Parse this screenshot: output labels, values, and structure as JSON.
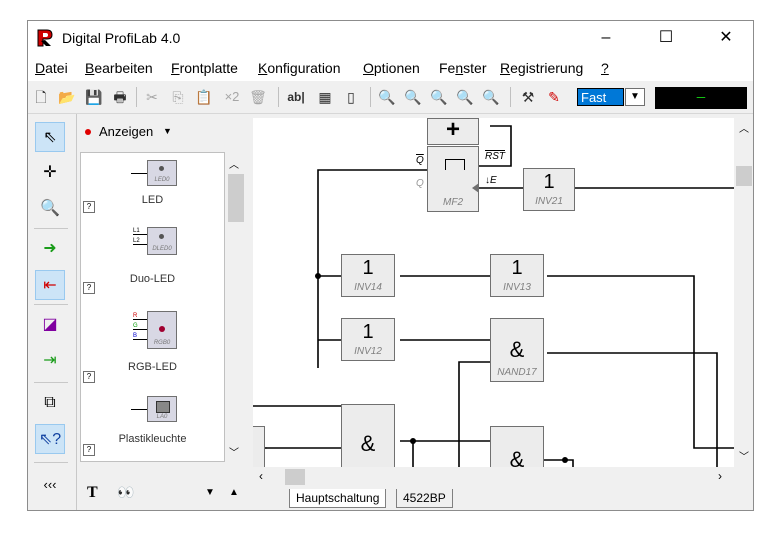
{
  "window": {
    "title": "Digital ProfiLab 4.0"
  },
  "menu": [
    {
      "ul": "D",
      "rest": "atei"
    },
    {
      "ul": "B",
      "rest": "earbeiten"
    },
    {
      "ul": "F",
      "rest": "rontplatte"
    },
    {
      "ul": "K",
      "rest": "onfiguration"
    },
    {
      "ul": "O",
      "rest": "ptionen"
    },
    {
      "pre": "Fe",
      "ul": "n",
      "rest": "ster"
    },
    {
      "ul": "R",
      "rest": "egistrierung"
    },
    {
      "ul": "?",
      "rest": ""
    }
  ],
  "toolbar": {
    "speed": "Fast",
    "display": "—",
    "x2_label": "×2",
    "ab_label": "ab|"
  },
  "library": {
    "category": "Anzeigen",
    "items": [
      {
        "label": "LED",
        "sublabel": "LED0"
      },
      {
        "label": "Duo-LED",
        "sublabel": "DLED0",
        "pins": [
          "L1",
          "L2"
        ]
      },
      {
        "label": "RGB-LED",
        "sublabel": "RGB0",
        "pins": [
          "R",
          "G",
          "B"
        ]
      },
      {
        "label": "Plastikleuchte",
        "sublabel": "LA0"
      }
    ]
  },
  "lefttools": {
    "collapse_label": "‹‹‹"
  },
  "tabs": [
    "Hauptschaltung",
    "4522BP"
  ],
  "circuit": {
    "mf2": {
      "name": "MF2",
      "q": "Q",
      "qbar": "Q",
      "rst": "RST",
      "e": "↓E"
    },
    "gates": [
      {
        "sym": "1",
        "name": "INV21"
      },
      {
        "sym": "1",
        "name": "INV14"
      },
      {
        "sym": "1",
        "name": "INV13"
      },
      {
        "sym": "1",
        "name": "INV12"
      },
      {
        "sym": "&",
        "name": "NAND17"
      },
      {
        "sym": "&",
        "name": ""
      },
      {
        "sym": "&",
        "name": ""
      },
      {
        "sym": "+",
        "name": ""
      }
    ]
  },
  "colors": {
    "accent": "#0078d7",
    "display_bg": "#000000",
    "display_fg": "#13d013",
    "led_red": "#e00000"
  }
}
